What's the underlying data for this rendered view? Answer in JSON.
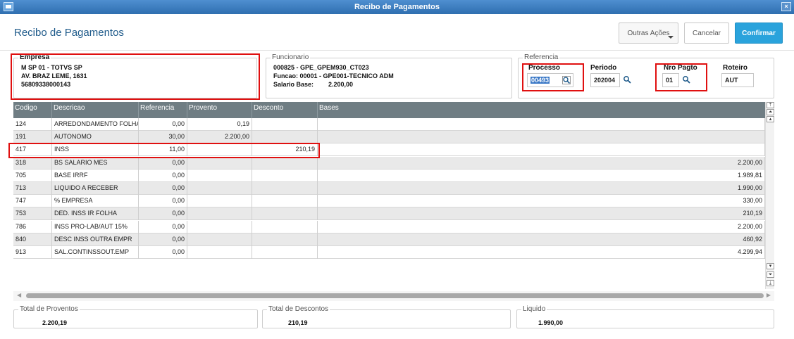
{
  "window": {
    "title": "Recibo de Pagamentos",
    "close_glyph": "×"
  },
  "header": {
    "title": "Recibo de Pagamentos",
    "outras_acoes": "Outras Ações",
    "cancelar": "Cancelar",
    "confirmar": "Confirmar"
  },
  "empresa": {
    "legend": "Empresa",
    "line1": "M SP 01  - TOTVS SP",
    "line2": "AV. BRAZ LEME, 1631",
    "line3": "56809338000143"
  },
  "funcionario": {
    "legend": "Funcionario",
    "line1": "000825 - GPE_GPEM930_CT023",
    "line2": "Funcao: 00001 - GPE001-TECNICO ADM",
    "salario_label": "Salario Base:",
    "salario_value": "2.200,00"
  },
  "referencia": {
    "legend": "Referencia",
    "processo_label": "Processo",
    "processo_value": "00493",
    "periodo_label": "Periodo",
    "periodo_value": "202004",
    "nro_pagto_label": "Nro Pagto",
    "nro_pagto_value": "01",
    "roteiro_label": "Roteiro",
    "roteiro_value": "AUT"
  },
  "grid": {
    "columns": [
      "Codigo",
      "Descricao",
      "Referencia",
      "Provento",
      "Desconto",
      "Bases"
    ],
    "rows": [
      {
        "codigo": "124",
        "descricao": "ARREDONDAMENTO FOLHA",
        "referencia": "0,00",
        "provento": "0,19",
        "desconto": "",
        "bases": ""
      },
      {
        "codigo": "191",
        "descricao": "AUTONOMO",
        "referencia": "30,00",
        "provento": "2.200,00",
        "desconto": "",
        "bases": ""
      },
      {
        "codigo": "417",
        "descricao": "INSS",
        "referencia": "11,00",
        "provento": "",
        "desconto": "210,19",
        "bases": ""
      },
      {
        "codigo": "318",
        "descricao": "BS SALARIO MES",
        "referencia": "0,00",
        "provento": "",
        "desconto": "",
        "bases": "2.200,00"
      },
      {
        "codigo": "705",
        "descricao": "BASE IRRF",
        "referencia": "0,00",
        "provento": "",
        "desconto": "",
        "bases": "1.989,81"
      },
      {
        "codigo": "713",
        "descricao": "LIQUIDO A RECEBER",
        "referencia": "0,00",
        "provento": "",
        "desconto": "",
        "bases": "1.990,00"
      },
      {
        "codigo": "747",
        "descricao": "% EMPRESA",
        "referencia": "0,00",
        "provento": "",
        "desconto": "",
        "bases": "330,00"
      },
      {
        "codigo": "753",
        "descricao": "DED. INSS IR FOLHA",
        "referencia": "0,00",
        "provento": "",
        "desconto": "",
        "bases": "210,19"
      },
      {
        "codigo": "786",
        "descricao": "INSS PRO-LAB/AUT 15%",
        "referencia": "0,00",
        "provento": "",
        "desconto": "",
        "bases": "2.200,00"
      },
      {
        "codigo": "840",
        "descricao": "DESC INSS OUTRA EMPR",
        "referencia": "0,00",
        "provento": "",
        "desconto": "",
        "bases": "460,92"
      },
      {
        "codigo": "913",
        "descricao": "SAL.CONTINSSOUT.EMP",
        "referencia": "0,00",
        "provento": "",
        "desconto": "",
        "bases": "4.299,94"
      }
    ],
    "highlighted_code": "417"
  },
  "totals": {
    "proventos_label": "Total de Proventos",
    "proventos_value": "2.200,19",
    "descontos_label": "Total de Descontos",
    "descontos_value": "210,19",
    "liquido_label": "Liquido",
    "liquido_value": "1.990,00"
  },
  "colors": {
    "titlebar": "#3a7cc0",
    "grid_header": "#6f7d83",
    "accent": "#2aa3dc",
    "highlight": "#e01010",
    "row_alt": "#e9e9e9"
  }
}
